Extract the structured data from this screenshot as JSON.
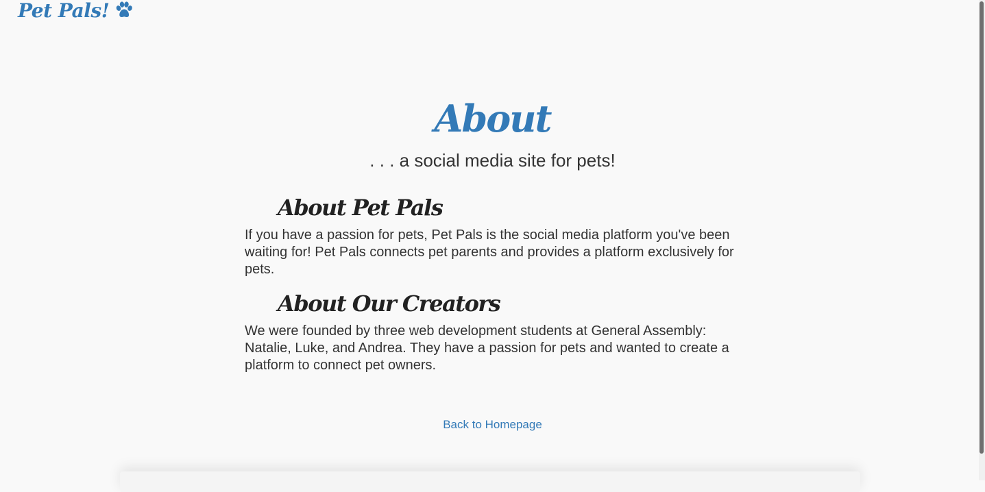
{
  "brand": {
    "name": "Pet Pals!",
    "icon": "paw-icon",
    "color": "#337ab7"
  },
  "page": {
    "title": "About",
    "tagline": ". . . a social media site for pets!"
  },
  "sections": [
    {
      "heading": "About Pet Pals",
      "text": "If you have a passion for pets, Pet Pals is the social media platform you've been waiting for! Pet Pals connects pet parents and provides a platform exclusively for pets."
    },
    {
      "heading": "About Our Creators",
      "text": "We were founded by three web development students at General Assembly: Natalie, Luke, and Andrea. They have a passion for pets and wanted to create a platform to connect pet owners."
    }
  ],
  "links": {
    "back_home": "Back to Homepage"
  },
  "colors": {
    "accent": "#337ab7",
    "background": "#f9f9f9",
    "text": "#333333"
  }
}
